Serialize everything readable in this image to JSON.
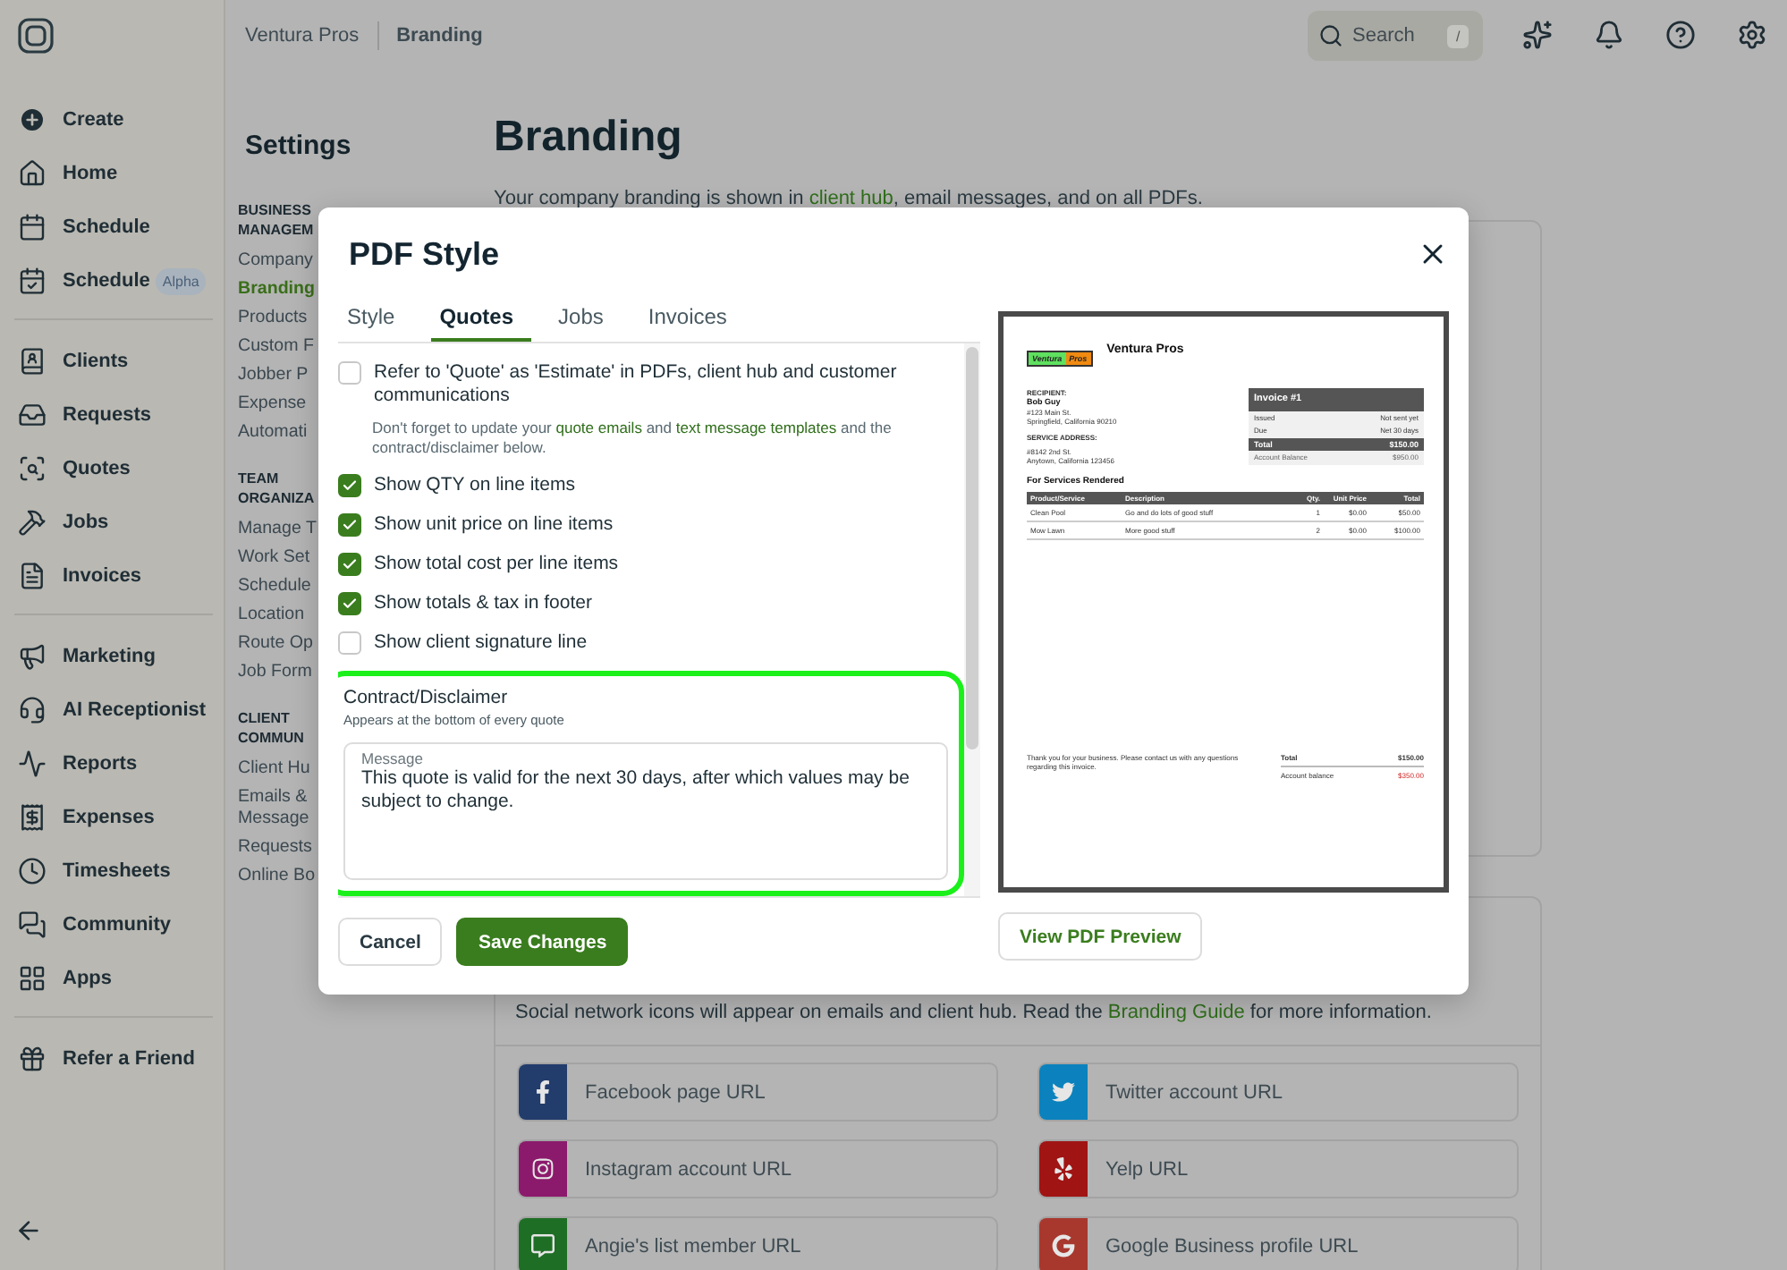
{
  "sidebar": {
    "groups": [
      [
        {
          "label": "Create"
        },
        {
          "label": "Home"
        },
        {
          "label": "Schedule"
        },
        {
          "label": "Schedule",
          "badge": "Alpha"
        }
      ],
      [
        {
          "label": "Clients"
        },
        {
          "label": "Requests"
        },
        {
          "label": "Quotes"
        },
        {
          "label": "Jobs"
        },
        {
          "label": "Invoices"
        }
      ],
      [
        {
          "label": "Marketing"
        },
        {
          "label": "AI Receptionist"
        },
        {
          "label": "Reports"
        },
        {
          "label": "Expenses"
        },
        {
          "label": "Timesheets"
        },
        {
          "label": "Community"
        },
        {
          "label": "Apps"
        }
      ],
      [
        {
          "label": "Refer a Friend"
        }
      ]
    ]
  },
  "topbar": {
    "breadcrumb": [
      "Ventura Pros",
      "Branding"
    ],
    "search": {
      "placeholder": "Search",
      "shortcut": "/"
    }
  },
  "settings_nav": {
    "title": "Settings",
    "sections": [
      {
        "heading": "BUSINESS MANAGEM",
        "items": [
          {
            "label": "Company",
            "selected": false
          },
          {
            "label": "Branding",
            "selected": true
          },
          {
            "label": "Products",
            "selected": false
          },
          {
            "label": "Custom F",
            "selected": false
          },
          {
            "label": "Jobber P",
            "selected": false
          },
          {
            "label": "Expense",
            "selected": false
          },
          {
            "label": "Automati",
            "selected": false
          }
        ]
      },
      {
        "heading": "TEAM ORGANIZA",
        "items": [
          {
            "label": "Manage T",
            "selected": false
          },
          {
            "label": "Work Set",
            "selected": false
          },
          {
            "label": "Schedule",
            "selected": false
          },
          {
            "label": "Location",
            "selected": false
          },
          {
            "label": "Route Op",
            "selected": false
          },
          {
            "label": "Job Form",
            "selected": false
          }
        ]
      },
      {
        "heading": "CLIENT COMMUN",
        "items": [
          {
            "label": "Client Hu",
            "selected": false
          },
          {
            "label": "Emails & Message",
            "selected": false
          },
          {
            "label": "Requests",
            "selected": false
          },
          {
            "label": "Online Bo",
            "selected": false
          }
        ]
      }
    ]
  },
  "page": {
    "title": "Branding",
    "intro": [
      {
        "text": "Your company branding is shown in "
      },
      {
        "text": "client hub",
        "link": true
      },
      {
        "text": ", email messages, and on all PDFs."
      }
    ],
    "social": {
      "note": [
        {
          "text": "Social network icons will appear on emails and client hub. Read the "
        },
        {
          "text": "Branding Guide",
          "link": true
        },
        {
          "text": " for more information."
        }
      ],
      "fields": [
        {
          "placeholder": "Facebook page URL",
          "color": "#223c6c"
        },
        {
          "placeholder": "Twitter account URL",
          "color": "#0b82bd"
        },
        {
          "placeholder": "Instagram account URL",
          "color": "#8c1a6c"
        },
        {
          "placeholder": "Yelp URL",
          "color": "#a01414"
        },
        {
          "placeholder": "Angie's list member URL",
          "color": "#1f6e26"
        },
        {
          "placeholder": "Google Business profile URL",
          "color": "#a8382e"
        }
      ]
    }
  },
  "modal": {
    "title": "PDF Style",
    "tabs": [
      {
        "label": "Style",
        "selected": false
      },
      {
        "label": "Quotes",
        "selected": true
      },
      {
        "label": "Jobs",
        "selected": false
      },
      {
        "label": "Invoices",
        "selected": false
      }
    ],
    "options": [
      {
        "label": "Refer to 'Quote' as 'Estimate' in PDFs, client hub and customer communications",
        "checked": false,
        "note": [
          {
            "text": "Don't forget to update your "
          },
          {
            "text": "quote emails",
            "link": true
          },
          {
            "text": " and "
          },
          {
            "text": "text message templates",
            "link": true
          },
          {
            "text": " and the contract/disclaimer below."
          }
        ]
      },
      {
        "label": "Show QTY on line items",
        "checked": true
      },
      {
        "label": "Show unit price on line items",
        "checked": true
      },
      {
        "label": "Show total cost per line items",
        "checked": true
      },
      {
        "label": "Show totals & tax in footer",
        "checked": true
      },
      {
        "label": "Show client signature line",
        "checked": false
      }
    ],
    "contract": {
      "title": "Contract/Disclaimer",
      "subtitle": "Appears at the bottom of every quote",
      "field_label": "Message",
      "value": "This quote is valid for the next 30 days, after which values may be subject to change."
    },
    "buttons": {
      "cancel": "Cancel",
      "save": "Save Changes",
      "preview": "View PDF Preview"
    },
    "preview": {
      "logo_words": [
        "Ventura",
        "Pros"
      ],
      "company": "Ventura Pros",
      "recipient_label": "RECIPIENT:",
      "recipient": "Bob Guy",
      "recipient_address": [
        "#123 Main St.",
        "Springfield, California 90210"
      ],
      "service_label": "SERVICE ADDRESS:",
      "service_address": [
        "#8142 2nd St.",
        "Anytown, California 123456"
      ],
      "summary_title": "Invoice #1",
      "summary_rows": [
        [
          "Issued",
          "Not sent yet"
        ],
        [
          "Due",
          "Net 30 days"
        ]
      ],
      "summary_total": [
        "Total",
        "$150.00"
      ],
      "summary_balance": [
        "Account Balance",
        "$950.00"
      ],
      "section": "For Services Rendered",
      "columns": [
        "Product/Service",
        "Description",
        "Qty.",
        "Unit Price",
        "Total"
      ],
      "rows": [
        [
          "Clean Pool",
          "Go and do lots of good stuff",
          "1",
          "$0.00",
          "$50.00"
        ],
        [
          "Mow Lawn",
          "More good stuff",
          "2",
          "$0.00",
          "$100.00"
        ]
      ],
      "footer_note": "Thank you for your business. Please contact us with any questions regarding this invoice.",
      "footer_total": [
        "Total",
        "$150.00"
      ],
      "footer_balance": [
        "Account balance",
        "$350.00"
      ]
    }
  }
}
